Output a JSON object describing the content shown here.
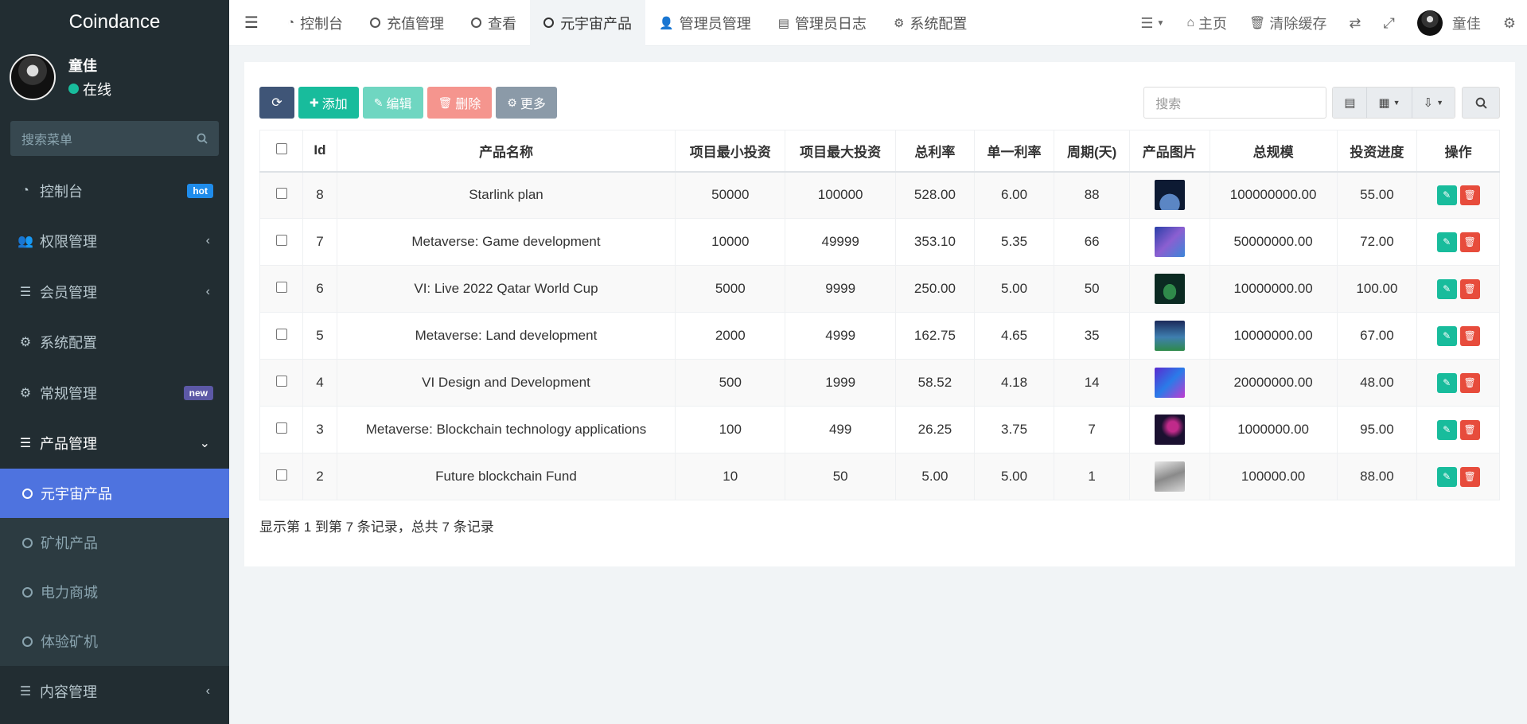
{
  "brand": "Coindance",
  "user": {
    "name": "童佳",
    "status": "在线"
  },
  "sidebar": {
    "search_placeholder": "搜索菜单",
    "items": [
      {
        "label": "控制台",
        "icon": "dashboard-icon",
        "badge": "hot"
      },
      {
        "label": "权限管理",
        "icon": "users-icon"
      },
      {
        "label": "会员管理",
        "icon": "list-icon"
      },
      {
        "label": "系统配置",
        "icon": "gear-icon"
      },
      {
        "label": "常规管理",
        "icon": "cogs-icon",
        "badge": "new"
      },
      {
        "label": "产品管理",
        "icon": "list-icon"
      }
    ],
    "subitems": [
      {
        "label": "元宇宙产品",
        "active": true
      },
      {
        "label": "矿机产品"
      },
      {
        "label": "电力商城"
      },
      {
        "label": "体验矿机"
      }
    ],
    "last_item": {
      "label": "内容管理",
      "icon": "list-icon"
    }
  },
  "topnav": {
    "tabs": [
      {
        "label": "控制台",
        "icon": "dashboard-icon"
      },
      {
        "label": "充值管理",
        "icon": "circle-icon"
      },
      {
        "label": "查看",
        "icon": "circle-icon"
      },
      {
        "label": "元宇宙产品",
        "icon": "circle-icon",
        "active": true
      },
      {
        "label": "管理员管理",
        "icon": "user-icon"
      },
      {
        "label": "管理员日志",
        "icon": "log-icon"
      },
      {
        "label": "系统配置",
        "icon": "gear-icon"
      }
    ],
    "right": {
      "home": "主页",
      "clear_cache": "清除缓存",
      "username": "童佳"
    }
  },
  "toolbar": {
    "add": "添加",
    "edit": "编辑",
    "delete": "删除",
    "more": "更多",
    "search_placeholder": "搜索"
  },
  "table": {
    "headers": [
      "Id",
      "产品名称",
      "项目最小投资",
      "项目最大投资",
      "总利率",
      "单一利率",
      "周期(天)",
      "产品图片",
      "总规模",
      "投资进度",
      "操作"
    ],
    "rows": [
      {
        "id": "8",
        "name": "Starlink plan",
        "min": "50000",
        "max": "100000",
        "total_rate": "528.00",
        "rate": "6.00",
        "period": "88",
        "scale": "100000000.00",
        "progress": "55.00"
      },
      {
        "id": "7",
        "name": "Metaverse: Game development",
        "min": "10000",
        "max": "49999",
        "total_rate": "353.10",
        "rate": "5.35",
        "period": "66",
        "scale": "50000000.00",
        "progress": "72.00"
      },
      {
        "id": "6",
        "name": "VI: Live 2022 Qatar World Cup",
        "min": "5000",
        "max": "9999",
        "total_rate": "250.00",
        "rate": "5.00",
        "period": "50",
        "scale": "10000000.00",
        "progress": "100.00"
      },
      {
        "id": "5",
        "name": "Metaverse: Land development",
        "min": "2000",
        "max": "4999",
        "total_rate": "162.75",
        "rate": "4.65",
        "period": "35",
        "scale": "10000000.00",
        "progress": "67.00"
      },
      {
        "id": "4",
        "name": "VI Design and Development",
        "min": "500",
        "max": "1999",
        "total_rate": "58.52",
        "rate": "4.18",
        "period": "14",
        "scale": "20000000.00",
        "progress": "48.00"
      },
      {
        "id": "3",
        "name": "Metaverse: Blockchain technology applications",
        "min": "100",
        "max": "499",
        "total_rate": "26.25",
        "rate": "3.75",
        "period": "7",
        "scale": "1000000.00",
        "progress": "95.00"
      },
      {
        "id": "2",
        "name": "Future blockchain Fund",
        "min": "10",
        "max": "50",
        "total_rate": "5.00",
        "rate": "5.00",
        "period": "1",
        "scale": "100000.00",
        "progress": "88.00"
      }
    ]
  },
  "footer": "显示第 1 到第 7 条记录，总共 7 条记录"
}
